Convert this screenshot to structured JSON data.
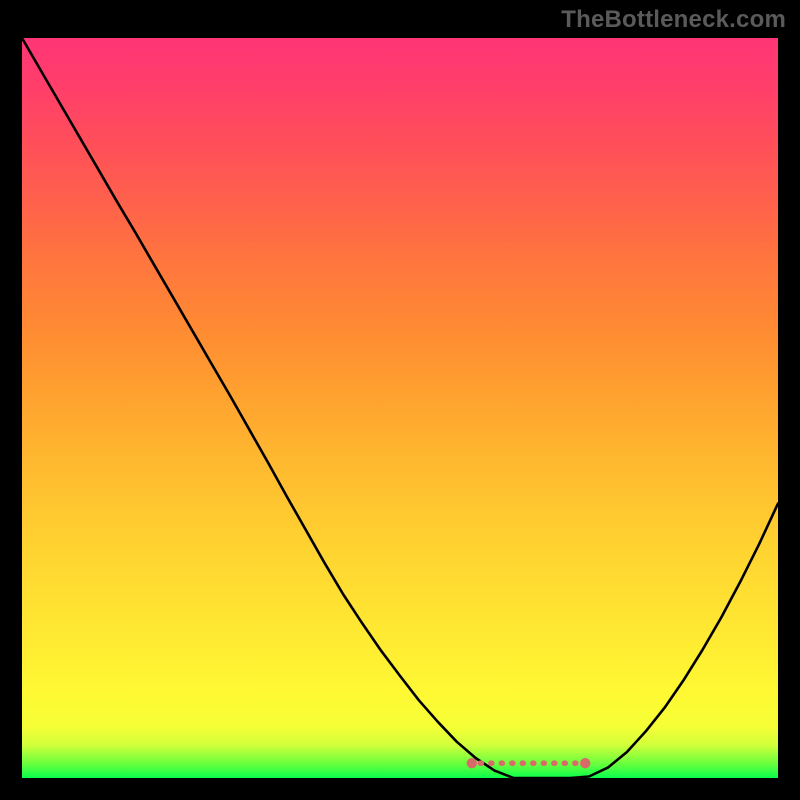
{
  "watermark": "TheBottleneck.com",
  "chart_data": {
    "type": "line",
    "title": "",
    "xlabel": "",
    "ylabel": "",
    "x": [
      0.0,
      0.025,
      0.05,
      0.075,
      0.1,
      0.125,
      0.15,
      0.175,
      0.2,
      0.225,
      0.25,
      0.275,
      0.3,
      0.325,
      0.35,
      0.375,
      0.4,
      0.425,
      0.45,
      0.475,
      0.5,
      0.525,
      0.55,
      0.575,
      0.6,
      0.625,
      0.65,
      0.675,
      0.7,
      0.725,
      0.75,
      0.775,
      0.8,
      0.825,
      0.85,
      0.875,
      0.9,
      0.925,
      0.95,
      0.975,
      1.0
    ],
    "values": [
      1.0,
      0.956,
      0.912,
      0.868,
      0.824,
      0.78,
      0.737,
      0.693,
      0.649,
      0.605,
      0.561,
      0.517,
      0.472,
      0.427,
      0.381,
      0.336,
      0.291,
      0.248,
      0.209,
      0.172,
      0.138,
      0.105,
      0.076,
      0.049,
      0.027,
      0.01,
      0.0,
      0.0,
      0.0,
      0.0,
      0.002,
      0.014,
      0.035,
      0.063,
      0.095,
      0.132,
      0.173,
      0.217,
      0.265,
      0.316,
      0.371
    ],
    "xlim": [
      0,
      1
    ],
    "ylim": [
      0,
      1
    ],
    "optimal_band": {
      "x_start": 0.595,
      "x_end": 0.745,
      "y": 0.02
    }
  },
  "colors": {
    "marker": "#d96a6a",
    "curve": "#000000",
    "top": "#ff3576",
    "bottom": "#09ff4b"
  }
}
